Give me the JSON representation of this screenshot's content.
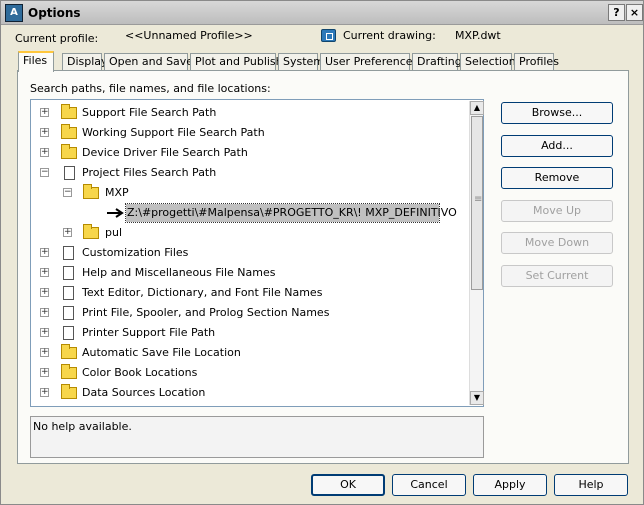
{
  "window": {
    "title": "Options",
    "help": "?",
    "close": "×"
  },
  "header": {
    "current_profile_label": "Current profile:",
    "current_profile_value": "<<Unnamed Profile>>",
    "current_drawing_label": "Current drawing:",
    "current_drawing_value": "MXP.dwt"
  },
  "tabs": [
    "Files",
    "Display",
    "Open and Save",
    "Plot and Publish",
    "System",
    "User Preferences",
    "Drafting",
    "Selection",
    "Profiles"
  ],
  "main": {
    "section_label": "Search paths, file names, and file locations:",
    "tree": [
      "Support File Search Path",
      "Working Support File Search Path",
      "Device Driver File Search Path",
      "Project Files Search Path",
      "MXP",
      "Z:\\#progetti\\#Malpensa\\#PROGETTO_KR\\! MXP_DEFINITIVO",
      "pul",
      "Customization Files",
      "Help and Miscellaneous File Names",
      "Text Editor, Dictionary, and Font File Names",
      "Print File, Spooler, and Prolog Section Names",
      "Printer Support File Path",
      "Automatic Save File Location",
      "Color Book Locations",
      "Data Sources Location"
    ],
    "help_text": "No help available."
  },
  "actions": [
    "Browse...",
    "Add...",
    "Remove",
    "Move Up",
    "Move Down",
    "Set Current"
  ],
  "footer": [
    "OK",
    "Cancel",
    "Apply",
    "Help"
  ],
  "colors": {
    "accent": "#ffc73c",
    "selection": "#c0c0c0"
  }
}
